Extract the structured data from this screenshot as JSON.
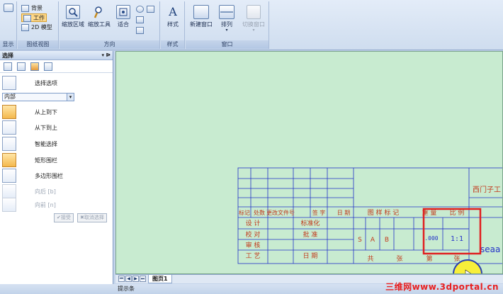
{
  "ribbon": {
    "display_label": "显示",
    "drawing_view": {
      "label": "图纸视图",
      "background": "背景",
      "work": "工作",
      "model2d": "2D 模型"
    },
    "direction": {
      "label": "方向",
      "zoom_area": "缩放区域",
      "zoom_tool": "缩放工具",
      "fit": "适合"
    },
    "style": {
      "label": "样式",
      "style_btn": "样式"
    },
    "window": {
      "label": "窗口",
      "new_window": "新建窗口",
      "arrange": "排列",
      "switch_window": "切换窗口"
    }
  },
  "panel": {
    "title": "选择",
    "select_options": "选择选项",
    "scope_value": "内部",
    "items": [
      {
        "label": "从上到下"
      },
      {
        "label": "从下到上"
      },
      {
        "label": "智能选择"
      },
      {
        "label": "矩形围栏"
      },
      {
        "label": "多边形围栏"
      },
      {
        "label": "向后 [b]"
      },
      {
        "label": "向前 [n]"
      }
    ],
    "accept": "接受",
    "cancel_select": "取消选择"
  },
  "titleblock": {
    "row_headers": [
      "标记",
      "处数",
      "更改文件号",
      "签  字",
      "日  期"
    ],
    "design": "设  计",
    "standard": "标准化",
    "check": "校  对",
    "approve": "批  准",
    "audit": "审  核",
    "process": "工  艺",
    "date": "日  期",
    "mark_header": "图 样 标 记",
    "mass_header": "重  量",
    "scale_header": "比  例",
    "marks": [
      "S",
      "A",
      "B"
    ],
    "mass_value": ".000",
    "scale_value": "1:1",
    "total": "共",
    "sheets": "张",
    "page_no": "第",
    "sheets2": "张",
    "company": "西门子工",
    "part_name": "seaa"
  },
  "tabs": {
    "page1": "图页1"
  },
  "status": {
    "text": "提示条"
  },
  "watermark": "三维网www.3dportal.cn",
  "colors": {
    "canvas_bg": "#c8ebd0",
    "line_blue": "#2433c8",
    "text_red": "#c23a1c",
    "highlight_red": "#e02020"
  }
}
